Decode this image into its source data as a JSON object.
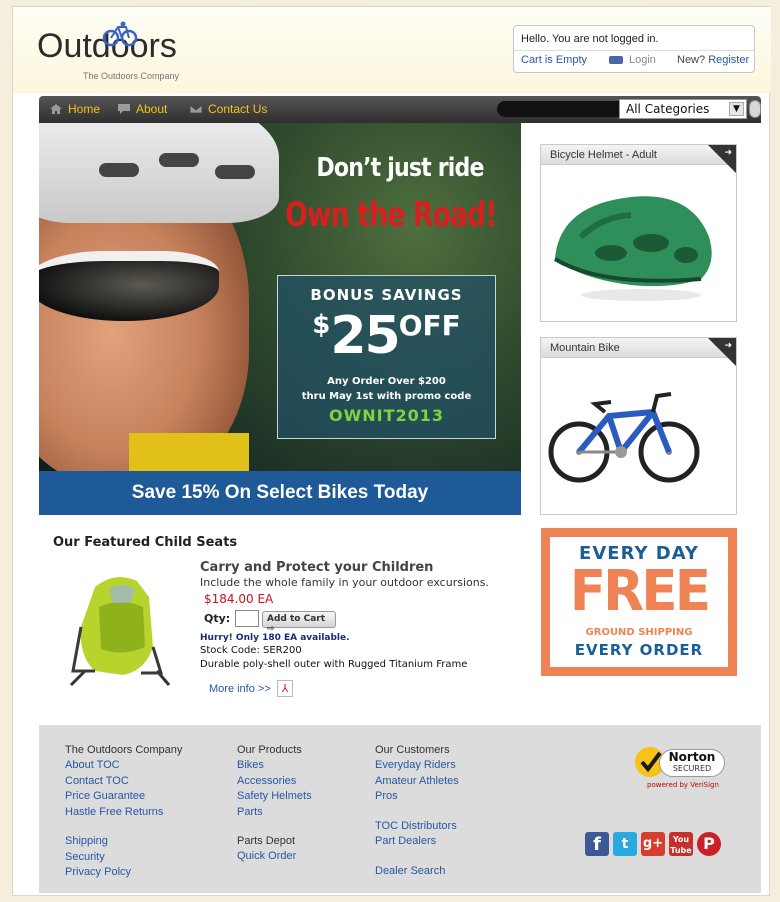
{
  "header": {
    "logo_text": "Outdoors",
    "logo_tagline": "The Outdoors Company",
    "account": {
      "greeting": "Hello. You are not logged in.",
      "cart_status": "Cart is Empty",
      "login_label": "Login",
      "new_prompt": "New?",
      "register_label": "Register"
    }
  },
  "nav": {
    "items": [
      {
        "label": "Home",
        "icon": "home-icon"
      },
      {
        "label": "About",
        "icon": "chat-icon"
      },
      {
        "label": "Contact Us",
        "icon": "envelope-icon"
      }
    ],
    "category_select": "All Categories"
  },
  "hero": {
    "headline": "Don’t just ride",
    "headline2": "Own the Road!",
    "promo": {
      "line1": "BONUS SAVINGS",
      "currency": "$",
      "amount": "25",
      "off": "OFF",
      "line3a": "Any Order Over $200",
      "line3b": "thru May 1st with promo code",
      "code": "OWNIT2013"
    },
    "banner": "Save 15% On Select Bikes Today"
  },
  "side_products": [
    {
      "title": "Bicycle Helmet - Adult",
      "image": "green-helmet"
    },
    {
      "title": "Mountain Bike",
      "image": "blue-mountain-bike"
    }
  ],
  "featured": {
    "heading": "Our Featured Child Seats",
    "title": "Carry and Protect your Children",
    "subtitle": "Include the whole family in your outdoor excursions.",
    "price": "$184.00 EA",
    "qty_label": "Qty:",
    "add_to_cart": "Add to Cart",
    "hurry": "Hurry! Only 180 EA available.",
    "stock_code": "Stock Code: SER200",
    "description": "Durable poly-shell outer with Rugged Titanium Frame",
    "more_info": "More info >>"
  },
  "free_shipping": {
    "line1": "EVERY DAY",
    "line2": "FREE",
    "line3": "GROUND SHIPPING",
    "line4": "EVERY ORDER"
  },
  "footer": {
    "col1": {
      "heading": "The Outdoors Company",
      "links": [
        "About TOC",
        "Contact TOC",
        "Price Guarantee",
        "Hastle Free Returns"
      ],
      "links2": [
        "Shipping",
        "Security",
        "Privacy Polcy"
      ]
    },
    "col2": {
      "heading": "Our Products",
      "links": [
        "Bikes",
        "Accessories",
        "Safety Helmets",
        "Parts"
      ],
      "heading2": "Parts Depot",
      "links2": [
        "Quick Order"
      ]
    },
    "col3": {
      "heading": "Our Customers",
      "links": [
        "Everyday Riders",
        "Amateur Athletes",
        "Pros"
      ],
      "links2": [
        "TOC Distributors",
        "Part Dealers"
      ],
      "links3": [
        "Dealer Search"
      ]
    },
    "norton": {
      "brand": "Norton",
      "secured": "SECURED",
      "powered": "powered by VeriSign"
    },
    "social": [
      "facebook-icon",
      "twitter-icon",
      "google-plus-icon",
      "youtube-icon",
      "pinterest-icon"
    ]
  }
}
